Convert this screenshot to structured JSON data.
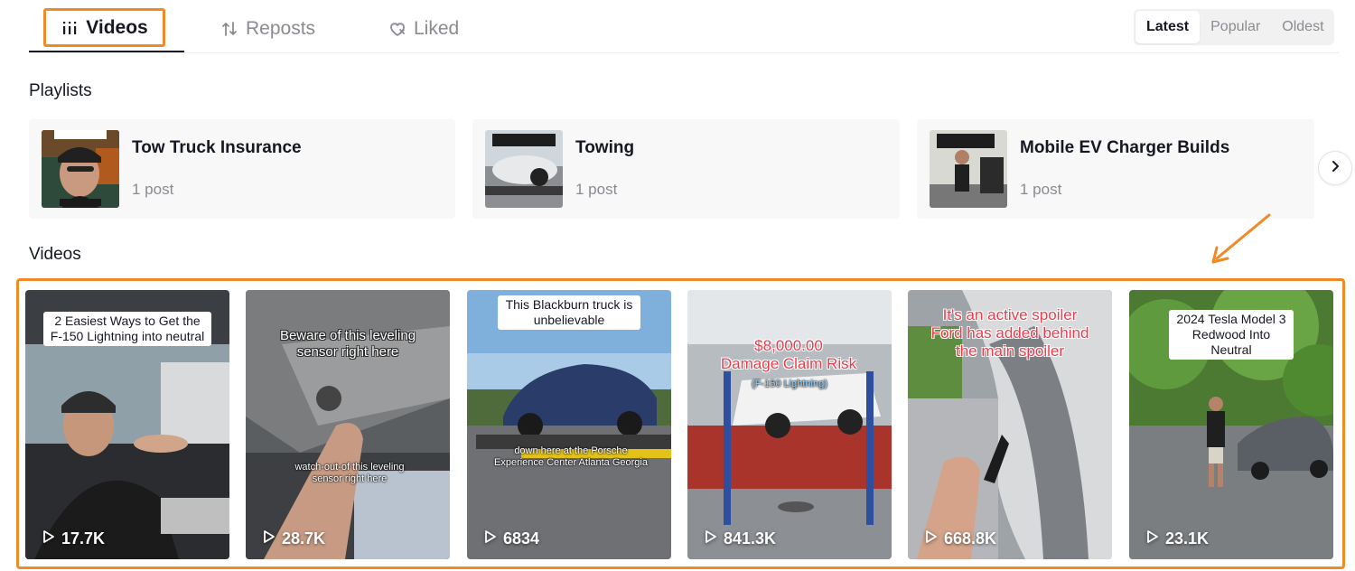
{
  "tabs": {
    "videos": "Videos",
    "reposts": "Reposts",
    "liked": "Liked"
  },
  "sort": {
    "latest": "Latest",
    "popular": "Popular",
    "oldest": "Oldest",
    "selected": "Latest"
  },
  "sections": {
    "playlists": "Playlists",
    "videos": "Videos"
  },
  "playlists": [
    {
      "name": "Tow Truck Insurance",
      "count": "1 post"
    },
    {
      "name": "Towing",
      "count": "1 post"
    },
    {
      "name": "Mobile EV Charger Builds",
      "count": "1 post"
    }
  ],
  "videos": [
    {
      "caption": "2 Easiest Ways to Get the F-150 Lightning into neutral",
      "views": "17.7K"
    },
    {
      "caption": "Beware of this leveling sensor right here",
      "subcaption": "watch-out-of this leveling sensor right here",
      "views": "28.7K"
    },
    {
      "caption": "This Blackburn truck is unbelievable",
      "subcaption": "down here at the Porsche Experience Center Atlanta Georgia",
      "views": "6834"
    },
    {
      "caption_line1": "$8,000.00",
      "caption_line2": "Damage Claim Risk",
      "caption_line3": "(F-150 Lightning)",
      "views": "841.3K"
    },
    {
      "caption": "It's an active spoiler Ford has added behind the main spoiler",
      "views": "668.8K"
    },
    {
      "caption": "2024 Tesla Model 3 Redwood Into Neutral",
      "views": "23.1K"
    }
  ],
  "colors": {
    "highlight": "#f08a24",
    "text": "#161823",
    "muted": "#8a8b91"
  }
}
